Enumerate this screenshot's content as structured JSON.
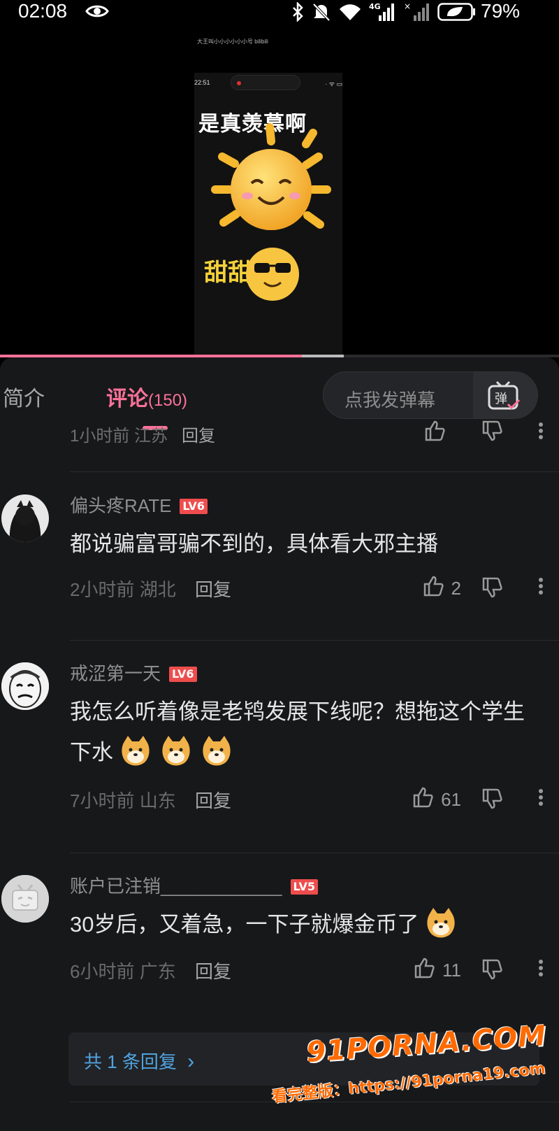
{
  "status_bar": {
    "time": "02:08",
    "battery": "79%",
    "icons": [
      "eye-icon",
      "bluetooth-icon",
      "mute-icon",
      "wifi-icon",
      "signal-4g-icon",
      "signal-icon",
      "battery-icon"
    ]
  },
  "video": {
    "top_caption": "大王叫小小小小小小号 bilibili",
    "inner_time": "22:51",
    "headline": "是真羡慕啊",
    "headline_b": "甜甜天",
    "progress": 0.54,
    "buffer_end": 0.615
  },
  "tabs": {
    "intro": "简介",
    "comments": "评论",
    "comments_count": "(150)"
  },
  "danmaku": {
    "placeholder": "点我发弹幕",
    "button_icon": "danmaku-send-icon"
  },
  "partial_row": {
    "meta": "1小时前 江苏",
    "reply": "回复"
  },
  "comments": [
    {
      "username": "偏头疼RATE",
      "level": "LV6",
      "content": "都说骗富哥骗不到的，具体看大邪主播",
      "time": "2小时前",
      "location": "湖北",
      "reply": "回复",
      "likes": "2"
    },
    {
      "username": "戒涩第一天",
      "level": "LV6",
      "content": "我怎么听着像是老鸨发展下线呢？想拖这个学生下水",
      "time": "7小时前",
      "location": "山东",
      "reply": "回复",
      "likes": "61"
    },
    {
      "username": "账户已注销____________",
      "level": "LV5",
      "content": "30岁后，又着急，一下子就爆金币了",
      "time": "6小时前",
      "location": "广东",
      "reply": "回复",
      "likes": "11"
    }
  ],
  "reply_box": {
    "text": "共 1 条回复",
    "chevron": "›"
  },
  "watermark": {
    "logo": "91PORNA.COM",
    "line": "看完整版：https://91porna19.com"
  },
  "colors": {
    "accent": "#fb7299",
    "level_badge": "#ee4d4d",
    "link_blue": "#4fa3e0",
    "panel_bg": "#17181a"
  }
}
